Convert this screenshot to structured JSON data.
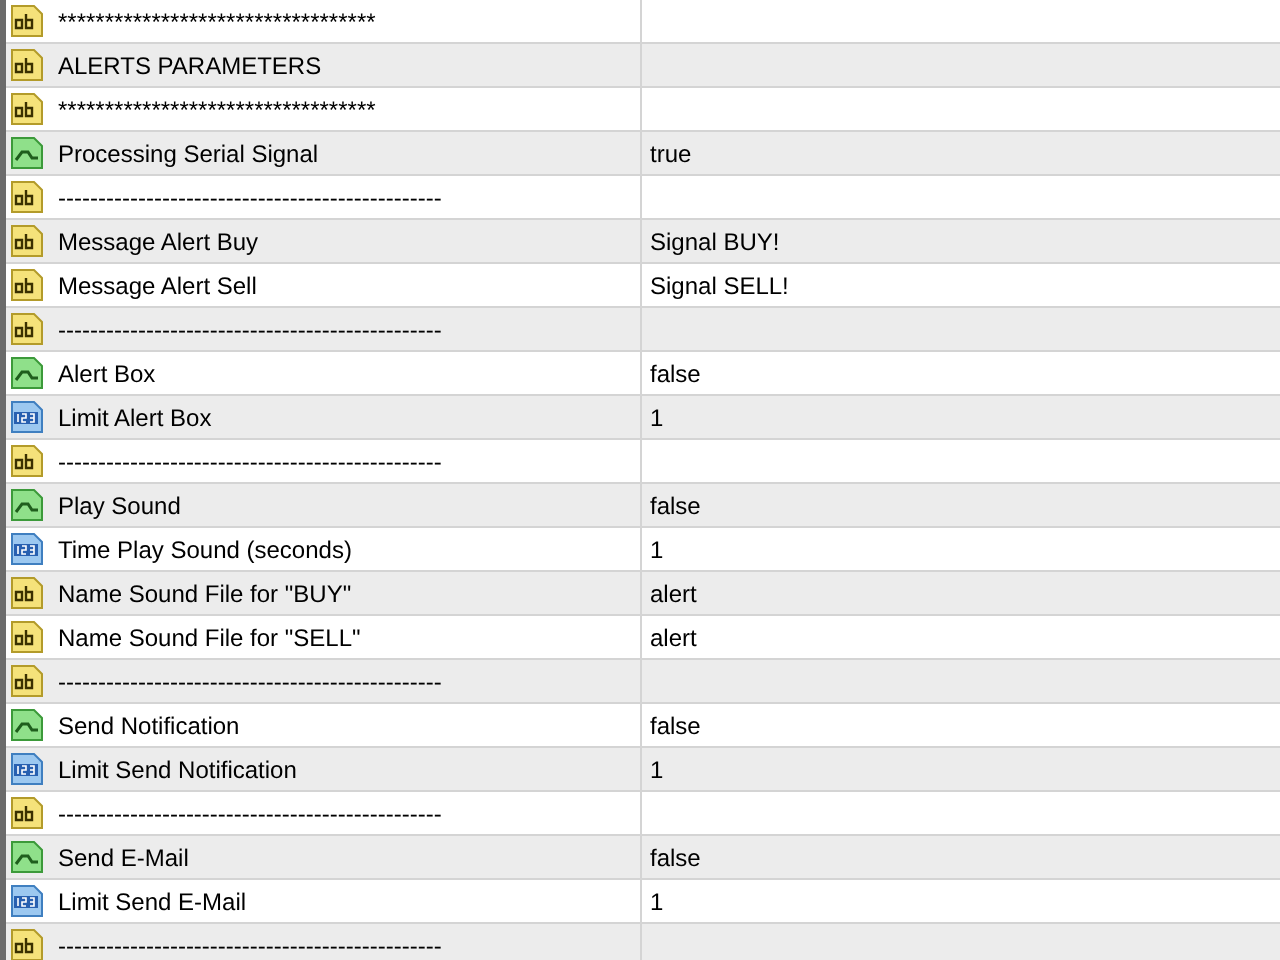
{
  "rows": [
    {
      "kind": "string",
      "name": "**********************************"
    },
    {
      "kind": "string",
      "name": "ALERTS PARAMETERS"
    },
    {
      "kind": "string",
      "name": "**********************************"
    },
    {
      "kind": "bool",
      "name": "Processing Serial Signal",
      "value": "true"
    },
    {
      "kind": "string",
      "name": "------------------------------------------------"
    },
    {
      "kind": "string",
      "name": "Message Alert Buy",
      "value": "Signal BUY!"
    },
    {
      "kind": "string",
      "name": "Message Alert Sell",
      "value": "Signal SELL!"
    },
    {
      "kind": "string",
      "name": "------------------------------------------------"
    },
    {
      "kind": "bool",
      "name": "Alert Box",
      "value": "false"
    },
    {
      "kind": "int",
      "name": "Limit Alert Box",
      "value": "1"
    },
    {
      "kind": "string",
      "name": "------------------------------------------------"
    },
    {
      "kind": "bool",
      "name": "Play Sound",
      "value": "false"
    },
    {
      "kind": "int",
      "name": "Time Play Sound (seconds)",
      "value": "1"
    },
    {
      "kind": "string",
      "name": "Name Sound File for \"BUY\"",
      "value": "alert"
    },
    {
      "kind": "string",
      "name": "Name Sound File for \"SELL\"",
      "value": "alert"
    },
    {
      "kind": "string",
      "name": "------------------------------------------------"
    },
    {
      "kind": "bool",
      "name": "Send Notification",
      "value": "false"
    },
    {
      "kind": "int",
      "name": "Limit Send Notification",
      "value": "1"
    },
    {
      "kind": "string",
      "name": "------------------------------------------------"
    },
    {
      "kind": "bool",
      "name": "Send E-Mail",
      "value": "false"
    },
    {
      "kind": "int",
      "name": "Limit Send E-Mail",
      "value": "1"
    },
    {
      "kind": "string",
      "name": "------------------------------------------------"
    }
  ]
}
